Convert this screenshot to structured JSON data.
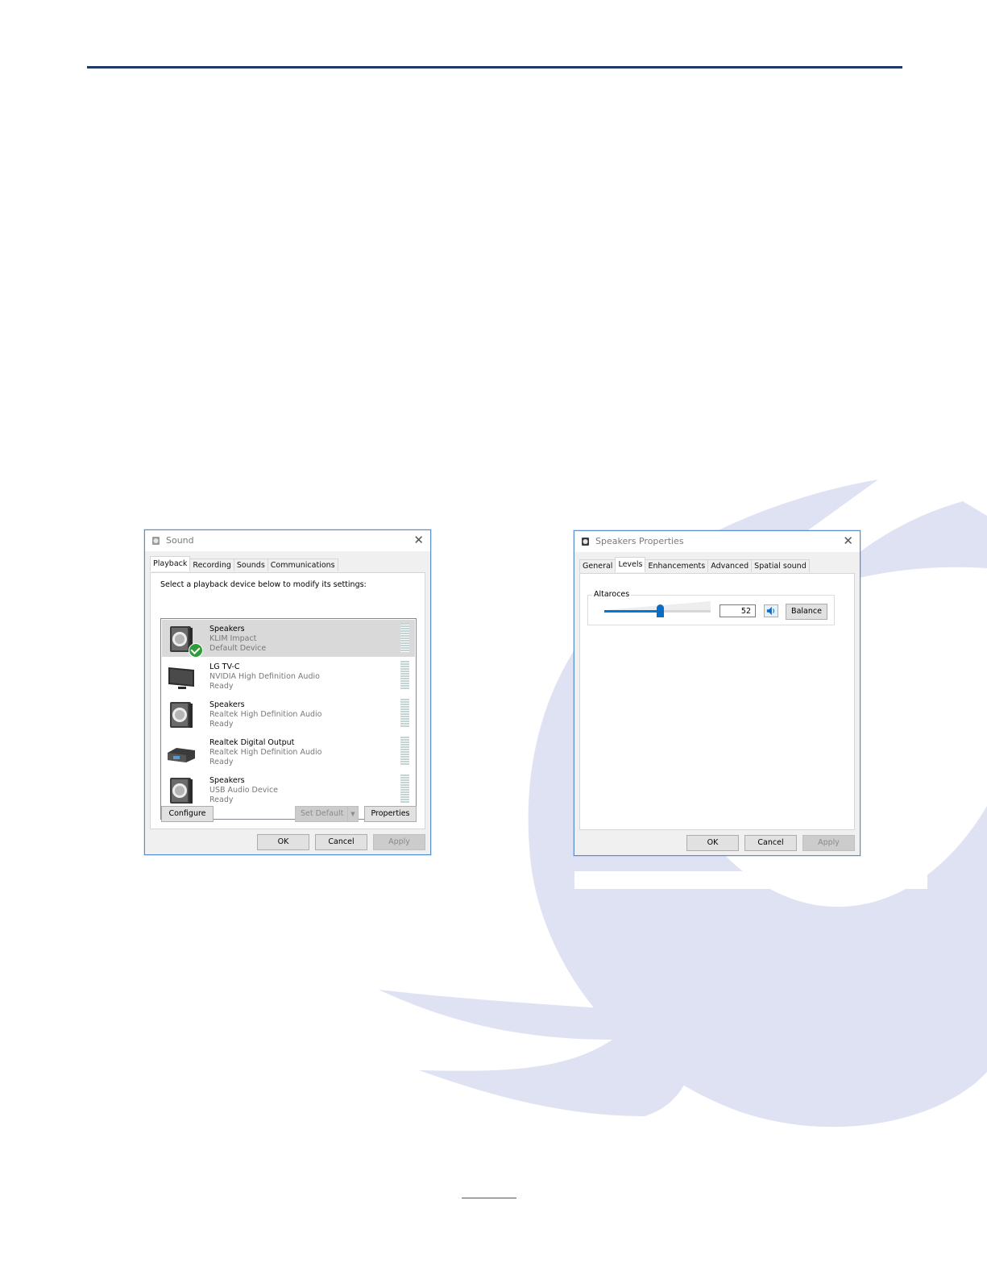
{
  "colors": {
    "accent": "#0078d7",
    "rule": "#1f3864",
    "watermark": "#dfe2f2"
  },
  "sound_dialog": {
    "title": "Sound",
    "tabs": [
      "Playback",
      "Recording",
      "Sounds",
      "Communications"
    ],
    "instruction": "Select a playback device below to modify its settings:",
    "devices": [
      {
        "name": "Speakers",
        "subtitle": "KLIM Impact",
        "status": "Default Device",
        "icon": "speaker-icon",
        "selected": true,
        "default": true
      },
      {
        "name": "LG TV-C",
        "subtitle": "NVIDIA High Definition Audio",
        "status": "Ready",
        "icon": "monitor-icon"
      },
      {
        "name": "Speakers",
        "subtitle": "Realtek High Definition Audio",
        "status": "Ready",
        "icon": "speaker-icon"
      },
      {
        "name": "Realtek Digital Output",
        "subtitle": "Realtek High Definition Audio",
        "status": "Ready",
        "icon": "digital-output-icon"
      },
      {
        "name": "Speakers",
        "subtitle": "USB Audio Device",
        "status": "Ready",
        "icon": "speaker-icon"
      }
    ],
    "buttons": {
      "configure": "Configure",
      "set_default": "Set Default",
      "properties": "Properties",
      "ok": "OK",
      "cancel": "Cancel",
      "apply": "Apply"
    }
  },
  "speakers_dialog": {
    "title": "Speakers Properties",
    "tabs": [
      "General",
      "Levels",
      "Enhancements",
      "Advanced",
      "Spatial sound"
    ],
    "levels": {
      "label": "Altaroces",
      "value": "52",
      "fraction": 0.52,
      "balance": "Balance"
    },
    "buttons": {
      "ok": "OK",
      "cancel": "Cancel",
      "apply": "Apply"
    }
  }
}
